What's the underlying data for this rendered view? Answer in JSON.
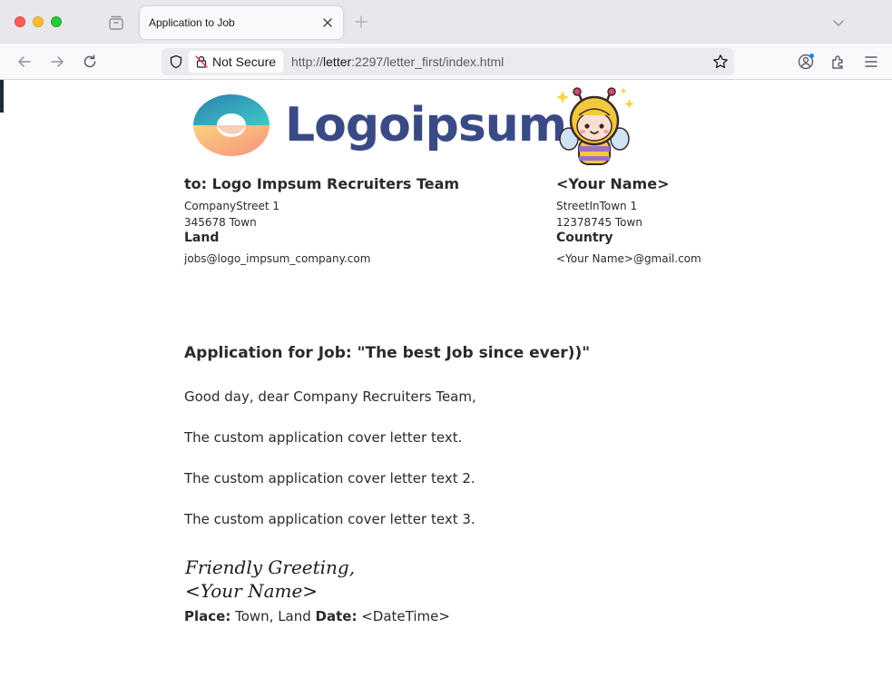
{
  "browser": {
    "tab_title": "Application to Job",
    "not_secure_label": "Not Secure",
    "url_prefix": "http://",
    "url_host": "letter",
    "url_rest": ":2297/letter_first/index.html"
  },
  "letter": {
    "logo_text": "Logoipsum",
    "recipient": {
      "name": "to: Logo Impsum Recruiters Team",
      "street": "CompanyStreet 1",
      "zip_town": "345678  Town",
      "land": "Land",
      "email": "jobs@logo_impsum_company.com"
    },
    "sender": {
      "name": "<Your Name>",
      "street": "StreetInTown 1",
      "zip_town": "12378745  Town",
      "country": "Country",
      "email": "<Your Name>@gmail.com"
    },
    "subject": "Application for Job: \"The best Job since ever))\"",
    "greeting": "Good day, dear Company Recruiters Team,",
    "paragraphs": [
      "The custom application cover letter text.",
      "The custom application cover letter text 2.",
      "The custom application cover letter text 3."
    ],
    "closing": "Friendly Greeting,",
    "signature_name": "<Your Name>",
    "place_label": "Place:",
    "place_value": " Town, Land ",
    "date_label": "Date:",
    "date_value": " <DateTime>"
  },
  "colors": {
    "logo_text": "#3a4a85",
    "body_text": "#2a2a2a",
    "tabbar_bg": "#e8e7ec",
    "toolbar_bg": "#f9f9fb"
  }
}
